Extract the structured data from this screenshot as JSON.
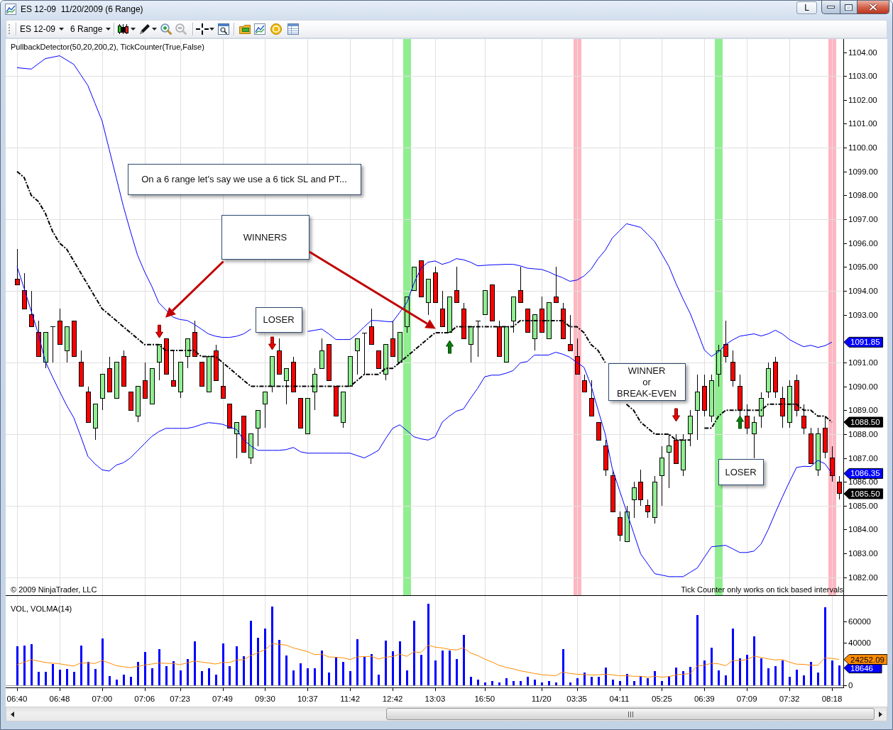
{
  "window": {
    "title": "ES 12-09  11/20/2009 (6 Range)",
    "button": "L"
  },
  "toolbar": {
    "instrument": "ES 12-09",
    "interval": "6 Range"
  },
  "price_panel": {
    "indicator_label": "PullbackDetector(50,20,200,2), TickCounter(True,False)",
    "copyright": "© 2009 NinjaTrader, LLC",
    "notice": "Tick Counter only works on tick based intervals",
    "chart_data": {
      "type": "candlestick",
      "ylim": [
        1081.25,
        1104.55
      ],
      "grid": true,
      "categories": [
        null,
        null,
        null,
        null,
        null,
        null,
        null,
        null,
        null,
        null,
        null,
        null,
        null,
        null,
        null,
        null,
        null,
        null,
        null,
        null,
        null,
        null,
        null,
        null,
        null,
        null,
        null,
        null,
        null,
        null,
        null,
        null,
        null,
        null,
        null,
        null,
        null,
        null,
        null,
        null,
        null,
        null,
        null,
        null,
        null,
        null,
        null,
        null,
        null,
        null,
        null,
        null,
        null,
        null,
        null,
        null,
        null,
        null,
        null,
        null,
        null,
        null,
        null,
        null,
        null,
        null,
        null,
        null,
        null,
        null,
        null,
        null,
        null,
        null,
        null,
        null,
        null,
        null,
        null,
        null,
        null,
        null,
        null,
        null,
        null,
        null,
        null,
        null,
        null,
        null,
        null,
        null,
        null,
        null,
        null,
        null,
        null,
        null,
        null,
        null,
        null,
        null,
        null,
        null,
        null,
        null,
        null,
        null,
        null,
        null,
        null,
        null,
        null,
        null,
        null,
        null,
        null
      ],
      "yticks": [
        {
          "value": 1082,
          "label": "1082.00"
        },
        {
          "value": 1083,
          "label": "1083.00"
        },
        {
          "value": 1084,
          "label": "1084.00"
        },
        {
          "value": 1085,
          "label": "1085.00"
        },
        {
          "value": 1086,
          "label": "1086.00"
        },
        {
          "value": 1087,
          "label": "1087.00"
        },
        {
          "value": 1088,
          "label": "1088.00"
        },
        {
          "value": 1089,
          "label": "1089.00"
        },
        {
          "value": 1090,
          "label": "1090.00"
        },
        {
          "value": 1091,
          "label": "1091.00"
        },
        {
          "value": 1093,
          "label": "1093.00"
        },
        {
          "value": 1094,
          "label": "1094.00"
        },
        {
          "value": 1095,
          "label": "1095.00"
        },
        {
          "value": 1096,
          "label": "1096.00"
        },
        {
          "value": 1097,
          "label": "1097.00"
        },
        {
          "value": 1098,
          "label": "1098.00"
        },
        {
          "value": 1099,
          "label": "1099.00"
        },
        {
          "value": 1100,
          "label": "1100.00"
        },
        {
          "value": 1101,
          "label": "1101.00"
        },
        {
          "value": 1102,
          "label": "1102.00"
        },
        {
          "value": 1103,
          "label": "1103.00"
        },
        {
          "value": 1104,
          "label": "1104.00"
        }
      ],
      "ohlc": [
        [
          1094.5,
          1095.75,
          1094.25,
          1094.25
        ],
        [
          1094,
          1094.75,
          1093.25,
          1093.25
        ],
        [
          1093,
          1094,
          1092.5,
          1092.5
        ],
        [
          1092.25,
          1092.75,
          1091.25,
          1091.25
        ],
        [
          1091,
          1092.25,
          1090.75,
          1092.25
        ],
        [
          1092.5,
          1092.5,
          1091,
          1092.5
        ],
        [
          1092.75,
          1093.25,
          1091.75,
          1091.75
        ],
        [
          1091.5,
          1092.5,
          1091,
          1092.5
        ],
        [
          1092.75,
          1092.75,
          1091.25,
          1091.25
        ],
        [
          1091,
          1091.5,
          1090,
          1090
        ],
        [
          1089.75,
          1090,
          1088.5,
          1088.5
        ],
        [
          1088.25,
          1089.25,
          1087.75,
          1089.25
        ],
        [
          1089.5,
          1090.5,
          1089,
          1090.5
        ],
        [
          1090.75,
          1091.25,
          1089.75,
          1089.75
        ],
        [
          1089.5,
          1091,
          1089.5,
          1091
        ],
        [
          1091.25,
          1091.5,
          1090,
          1090
        ],
        [
          1089.75,
          1089.75,
          1089,
          1089
        ],
        [
          1088.75,
          1090,
          1088.5,
          1090
        ],
        [
          1090.25,
          1091,
          1089.5,
          1089.5
        ],
        [
          1089.25,
          1090.75,
          1089.25,
          1090.75
        ],
        [
          1091,
          1091.75,
          1090.25,
          1091.75
        ],
        [
          1092,
          1092,
          1090.5,
          1090.5
        ],
        [
          1090.25,
          1091.5,
          1090,
          1090
        ],
        [
          1089.75,
          1091,
          1089.5,
          1091
        ],
        [
          1091.25,
          1092,
          1090.75,
          1092
        ],
        [
          1092.25,
          1092.75,
          1091.25,
          1091.25
        ],
        [
          1091,
          1091,
          1090,
          1090
        ],
        [
          1089.75,
          1091.25,
          1089.75,
          1091.25
        ],
        [
          1091.5,
          1091.75,
          1090.25,
          1090.25
        ],
        [
          1090,
          1091,
          1089.5,
          1089.5
        ],
        [
          1089.25,
          1089.25,
          1088.25,
          1088.25
        ],
        [
          1088,
          1088.5,
          1087,
          1088.5
        ],
        [
          1088.75,
          1088.75,
          1087.25,
          1087.25
        ],
        [
          1087,
          1088,
          1086.75,
          1088
        ],
        [
          1088.25,
          1089,
          1087.5,
          1089
        ],
        [
          1089.25,
          1089.75,
          1088.25,
          1089.75
        ],
        [
          1090,
          1091.25,
          1089.75,
          1091.25
        ],
        [
          1091.5,
          1092,
          1090.5,
          1090.5
        ],
        [
          1090.25,
          1090.75,
          1089.25,
          1090.75
        ],
        [
          1091,
          1091.25,
          1089.75,
          1089.75
        ],
        [
          1089.5,
          1089.5,
          1088.25,
          1088.25
        ],
        [
          1088,
          1089.5,
          1088,
          1089.5
        ],
        [
          1089.75,
          1090.75,
          1089,
          1090.5
        ],
        [
          1090.75,
          1092,
          1090.75,
          1091.5
        ],
        [
          1091.75,
          1091.75,
          1090.25,
          1090.25
        ],
        [
          1090,
          1090,
          1088.75,
          1088.75
        ],
        [
          1088.5,
          1089.75,
          1088.25,
          1089.75
        ],
        [
          1090,
          1091.25,
          1090,
          1091.25
        ],
        [
          1091.5,
          1092,
          1090.5,
          1092
        ],
        [
          1092.25,
          1092.25,
          1090.5,
          1092.25
        ],
        [
          1092.5,
          1093.25,
          1091.75,
          1091.75
        ],
        [
          1091.5,
          1091.5,
          1090.75,
          1090.75
        ],
        [
          1090.5,
          1091.75,
          1090.25,
          1091.75
        ],
        [
          1092,
          1092.75,
          1091.25,
          1091.25
        ],
        [
          1091,
          1092.25,
          1091,
          1092.25
        ],
        [
          1092.5,
          1093.75,
          1092.25,
          1093.75
        ],
        [
          1094,
          1095,
          1094,
          1095
        ],
        [
          1095.25,
          1095.25,
          1093.75,
          1093.75
        ],
        [
          1093.5,
          1094.5,
          1093,
          1094.5
        ],
        [
          1094.75,
          1095,
          1093.5,
          1093.5
        ],
        [
          1093.25,
          1094,
          1092.5,
          1092.5
        ],
        [
          1092.25,
          1093.75,
          1092.25,
          1093.75
        ],
        [
          1094,
          1095,
          1093.5,
          1093.5
        ],
        [
          1093.25,
          1093.5,
          1092,
          1092
        ],
        [
          1091.75,
          1092.5,
          1091,
          1092.5
        ],
        [
          1092.75,
          1092.75,
          1091.25,
          1092.75
        ],
        [
          1093,
          1094,
          1093,
          1094
        ],
        [
          1094.25,
          1094.25,
          1092.75,
          1092.75
        ],
        [
          1092.5,
          1092.75,
          1091.25,
          1091.25
        ],
        [
          1091,
          1092.5,
          1091,
          1092.5
        ],
        [
          1092.75,
          1093.75,
          1092.25,
          1093.75
        ],
        [
          1094,
          1095,
          1093.5,
          1093.5
        ],
        [
          1093.25,
          1093.25,
          1092.25,
          1092.25
        ],
        [
          1092,
          1093,
          1091.5,
          1093
        ],
        [
          1093.25,
          1093.75,
          1092.25,
          1092.25
        ],
        [
          1092,
          1093.5,
          1092,
          1093.5
        ],
        [
          1093.75,
          1095,
          1093.5,
          1093.5
        ],
        [
          1093.25,
          1093.5,
          1092,
          1092
        ],
        [
          1091.75,
          1093,
          1091.5,
          1091.5
        ],
        [
          1091.25,
          1092,
          1090.5,
          1090.5
        ],
        [
          1090.25,
          1090.5,
          1089.75,
          1089.75
        ],
        [
          1089.5,
          1090.25,
          1088.75,
          1088.75
        ],
        [
          1088.5,
          1088.5,
          1087.75,
          1087.75
        ],
        [
          1087.5,
          1087.75,
          1086.25,
          1086.5
        ],
        [
          1086.25,
          1086.5,
          1084.75,
          1084.75
        ],
        [
          1084.5,
          1084.75,
          1083.5,
          1083.75
        ],
        [
          1083.5,
          1085,
          1083.5,
          1084.75
        ],
        [
          1085.25,
          1086,
          1084.5,
          1085.75
        ],
        [
          1086,
          1086.5,
          1085,
          1085.25
        ],
        [
          1085,
          1085.25,
          1084.5,
          1084.75
        ],
        [
          1084.5,
          1086.25,
          1084.25,
          1086
        ],
        [
          1086.25,
          1087.5,
          1085,
          1087
        ],
        [
          1087.25,
          1088,
          1085.75,
          1087.5
        ],
        [
          1087.75,
          1088,
          1086.75,
          1086.75
        ],
        [
          1086.5,
          1088,
          1086.25,
          1087.75
        ],
        [
          1088,
          1089,
          1087.5,
          1088.75
        ],
        [
          1089,
          1090.5,
          1087.75,
          1089.75
        ],
        [
          1090,
          1090.5,
          1088.75,
          1089
        ],
        [
          1088.75,
          1090.5,
          1088.5,
          1090.25
        ],
        [
          1090.5,
          1091.75,
          1090,
          1091.5
        ],
        [
          1091.75,
          1092.75,
          1091,
          1091.25
        ],
        [
          1091,
          1091.5,
          1090,
          1090.25
        ],
        [
          1090,
          1090.5,
          1088.75,
          1089
        ],
        [
          1088.75,
          1089.25,
          1088,
          1088.25
        ],
        [
          1088,
          1088.75,
          1087,
          1088.5
        ],
        [
          1088.75,
          1089.75,
          1088.25,
          1089.5
        ],
        [
          1089.75,
          1091,
          1089.5,
          1090.75
        ],
        [
          1091,
          1091.25,
          1089.5,
          1089.75
        ],
        [
          1089.5,
          1090,
          1088.25,
          1088.75
        ],
        [
          1088.5,
          1090.25,
          1088.25,
          1090
        ],
        [
          1090.25,
          1090.5,
          1088.75,
          1089
        ],
        [
          1088.75,
          1089.25,
          1088,
          1088.25
        ],
        [
          1088,
          1088.25,
          1086.75,
          1086.75
        ],
        [
          1086.5,
          1088.25,
          1086.25,
          1088
        ],
        [
          1088.25,
          1088.75,
          1087,
          1087.25
        ],
        [
          1087,
          1087.5,
          1086,
          1086.25
        ],
        [
          1086,
          1086.25,
          1085.25,
          1085.5
        ]
      ],
      "series": [
        {
          "type": "line",
          "color": "#0000ff",
          "values": [
            1103.35,
            1103.32,
            1103.29,
            1103.51,
            1103.73,
            1103.79,
            1103.85,
            1103.67,
            1103.49,
            1103.05,
            1102.6,
            1101.86,
            1101.12,
            1099.93,
            1098.74,
            1097.55,
            1096.5,
            1095.5,
            1094.8,
            1094.2,
            1093.5,
            1093.2,
            1092.9,
            1092.8,
            1092.76,
            1092.6,
            1092.4,
            1092.2,
            1092.1,
            1092.05,
            1092.05,
            1092.1,
            1092.2,
            1092.4,
            null,
            null,
            null,
            null,
            null,
            null,
            null,
            1092.3,
            1092.35,
            1092.4,
            1092.2,
            1091.96,
            1091.96,
            1091.96,
            1092.2,
            1092.5,
            1092.76,
            1092.75,
            1092.72,
            1092.7,
            1093.1,
            1093.5,
            1094.3,
            1094.95,
            1095.2,
            1095.25,
            1095.11,
            1095.2,
            1095.35,
            1095.3,
            1095.2,
            1095.05,
            1095.07,
            1095.09,
            1095.1,
            1095.11,
            1095.11,
            1095.05,
            1094.95,
            1094.92,
            1094.9,
            1094.8,
            1094.66,
            1094.55,
            1094.4,
            1094.45,
            1094.62,
            1094.9,
            1095.35,
            1095.7,
            1096.21,
            1096.51,
            1096.81,
            1096.74,
            1096.66,
            1096.36,
            1096.06,
            1095.54,
            1095.02,
            1094.3,
            1093.65,
            1093.05,
            1092.3,
            1091.52,
            1091.25,
            1091.45,
            1091.75,
            1091.95,
            1092.1,
            1092.15,
            1092.2,
            1092.11,
            1092.2,
            1092.35,
            1092.2,
            1091.96,
            1091.8,
            1091.66,
            1091.72,
            1091.63,
            1091.7,
            1091.85,
            null
          ]
        },
        {
          "type": "line",
          "color": "#0000ff",
          "values": [
            1095.02,
            1094.1,
            1093.15,
            1092.21,
            1091.04,
            1090.4,
            1089.79,
            1089.2,
            1088.69,
            1087.9,
            1087.07,
            1086.75,
            1086.5,
            1086.45,
            1086.7,
            1086.8,
            1087,
            1087.3,
            1087.6,
            1087.9,
            1088.1,
            1088.24,
            1088.24,
            1088.24,
            1088.24,
            1088.3,
            1088.4,
            1088.48,
            1088.45,
            1088.41,
            1088.3,
            1088.19,
            1087.75,
            1087.5,
            1087.32,
            1087.32,
            1087.32,
            1087.32,
            1087.35,
            1087.44,
            1087.26,
            1087.2,
            1087.2,
            1087.2,
            1087.2,
            1087.2,
            1087.2,
            1087.2,
            1087.1,
            1087,
            1087.15,
            1087.32,
            1087.8,
            1088.24,
            1088.39,
            1088.15,
            1087.89,
            1087.8,
            1087.75,
            1087.89,
            1088.5,
            1088.75,
            1088.96,
            1089.05,
            1089.5,
            1089.92,
            1090.4,
            1090.47,
            1090.47,
            1090.55,
            1090.66,
            1090.98,
            1091.04,
            1091.31,
            1091.31,
            1091.31,
            1091.43,
            1091.35,
            1091.22,
            1091,
            1090.8,
            1090.04,
            1089,
            1088,
            1086.55,
            1085.66,
            1084.77,
            1083.87,
            1082.98,
            1082.56,
            1082.15,
            1082.09,
            1082.03,
            1082.03,
            1082.03,
            1082.21,
            1082.39,
            1082.84,
            1083.28,
            1083.31,
            1083.34,
            1083.19,
            1083.04,
            1083.04,
            1083.1,
            1083.4,
            1084,
            1084.7,
            1085.36,
            1086,
            1086.6,
            1086.65,
            1086.64,
            1086.9,
            1086.76,
            1086.35,
            null
          ]
        },
        {
          "type": "line",
          "line_style": "dashdot",
          "color": "#000000",
          "values": [
            1099,
            1098.75,
            1098,
            1097.75,
            1097.25,
            1096.5,
            1096,
            1095.75,
            1095.25,
            1094.75,
            1094.25,
            1093.75,
            1093.25,
            1093,
            1092.75,
            1092.5,
            1092.25,
            1092,
            1091.75,
            1091.75,
            1091.75,
            1091.5,
            1091.5,
            1091.5,
            1091.5,
            1091.5,
            1091.25,
            1091.25,
            1091.25,
            1091,
            1090.75,
            1090.5,
            1090.25,
            1090,
            1090,
            1090,
            1090,
            1090,
            1090,
            1090,
            1090,
            1090,
            1090,
            1090,
            1090,
            1090,
            1090,
            1090,
            1090.25,
            1090.5,
            1090.5,
            1090.5,
            1090.75,
            1090.75,
            1091,
            1091.25,
            1091.5,
            1091.75,
            1092,
            1092.25,
            1092.25,
            1092.25,
            1092.5,
            1092.5,
            1092.5,
            1092.5,
            1092.5,
            1092.5,
            1092.5,
            1092.5,
            1092.5,
            1092.75,
            1092.75,
            1092.75,
            1092.75,
            1092.75,
            1092.75,
            1092.75,
            1092.5,
            1092.5,
            1092.25,
            1091.75,
            1091.5,
            1091,
            null,
            null,
            1089.25,
            1089,
            1088.5,
            1088.25,
            1088,
            1088,
            1088,
            1087.75,
            1087.75,
            1087.75,
            null,
            1088.25,
            1088.25,
            1088.75,
            1089,
            1089,
            1089,
            1089,
            1089,
            1089,
            1089.25,
            1089.25,
            1089.25,
            1089.25,
            1089.25,
            1089,
            1089,
            1088.75,
            1088.75,
            1088.5,
            null
          ]
        },
        {
          "type": "scatter",
          "color": "#e80000",
          "values": [
            null,
            null,
            null,
            null,
            null,
            null,
            null,
            null,
            null,
            null,
            null,
            null,
            null,
            null,
            null,
            null,
            null,
            null,
            null,
            null,
            1092.3,
            null,
            null,
            null,
            null,
            null,
            null,
            null,
            null,
            null,
            null,
            null,
            null,
            null,
            null,
            null,
            1091.8,
            null,
            null,
            null,
            null,
            null,
            null,
            null,
            null,
            null,
            null,
            null,
            null,
            null,
            null,
            null,
            null,
            null,
            null,
            null,
            null,
            null,
            null,
            null,
            null,
            null,
            null,
            null,
            null,
            null,
            null,
            null,
            null,
            null,
            null,
            null,
            null,
            null,
            null,
            null,
            null,
            null,
            null,
            null,
            null,
            null,
            null,
            null,
            null,
            null,
            null,
            null,
            null,
            null,
            null,
            null,
            null,
            1088.8,
            null,
            null,
            null,
            null,
            null,
            null,
            null,
            null,
            null,
            null,
            null,
            null,
            null,
            null,
            null,
            null,
            null,
            null,
            null,
            null,
            null,
            null,
            null
          ]
        },
        {
          "type": "scatter",
          "color": "#0a7d0a",
          "values": [
            null,
            null,
            null,
            null,
            null,
            null,
            null,
            null,
            null,
            null,
            null,
            null,
            null,
            null,
            null,
            null,
            null,
            null,
            null,
            null,
            null,
            null,
            null,
            null,
            null,
            null,
            null,
            null,
            null,
            null,
            null,
            null,
            null,
            null,
            null,
            null,
            null,
            null,
            null,
            null,
            null,
            null,
            null,
            null,
            null,
            null,
            null,
            null,
            null,
            null,
            null,
            null,
            null,
            null,
            null,
            null,
            null,
            null,
            null,
            null,
            null,
            1091.65,
            null,
            null,
            null,
            null,
            null,
            null,
            null,
            null,
            null,
            null,
            null,
            null,
            null,
            null,
            null,
            null,
            null,
            null,
            null,
            null,
            null,
            null,
            null,
            null,
            null,
            null,
            null,
            null,
            null,
            null,
            null,
            null,
            null,
            null,
            null,
            null,
            null,
            null,
            null,
            null,
            1088.5,
            null,
            null,
            null,
            null,
            null,
            null,
            null,
            null,
            null,
            null,
            null,
            null,
            null,
            null
          ]
        }
      ],
      "annotations": [
        "On a 6 range let's say we use a 6 tick SL and PT...",
        "WINNERS",
        "LOSER",
        "WINNER\nor\nBREAK-EVEN",
        "LOSER",
        "1091.85",
        "1088.50",
        "1086.35",
        "1085.50"
      ]
    }
  },
  "volume_panel": {
    "label": "VOL, VOLMA(14)",
    "chart_data": {
      "type": "bar",
      "ylim": [
        0,
        84000
      ],
      "yticks": [
        0,
        40000,
        60000
      ],
      "grid": true,
      "categories": [
        "06:40",
        null,
        null,
        null,
        null,
        null,
        "06:48",
        null,
        null,
        null,
        null,
        null,
        "07:00",
        null,
        null,
        null,
        null,
        null,
        "07:06",
        null,
        null,
        null,
        null,
        "07:23",
        null,
        null,
        null,
        null,
        null,
        "07:49",
        null,
        null,
        null,
        null,
        null,
        "09:30",
        null,
        null,
        null,
        null,
        null,
        "10:37",
        null,
        null,
        null,
        null,
        null,
        "11:42",
        null,
        null,
        null,
        null,
        null,
        "12:42",
        null,
        null,
        null,
        null,
        null,
        "13:03",
        null,
        null,
        null,
        null,
        null,
        null,
        "16:50",
        null,
        null,
        null,
        null,
        null,
        null,
        null,
        "11/20",
        null,
        null,
        null,
        null,
        "03:35",
        null,
        null,
        null,
        null,
        null,
        "04:11",
        null,
        null,
        null,
        null,
        null,
        "05:25",
        null,
        null,
        null,
        null,
        null,
        "06:39",
        null,
        null,
        null,
        null,
        null,
        "07:09",
        null,
        null,
        null,
        null,
        null,
        "07:32",
        null,
        null,
        null,
        null,
        null,
        "08:18",
        null
      ],
      "series": [
        {
          "color": "#0000ff",
          "values": [
            36600,
            37200,
            38500,
            12900,
            12900,
            19700,
            15000,
            15500,
            12900,
            37200,
            21800,
            15500,
            44200,
            9000,
            5100,
            10300,
            7700,
            21800,
            31400,
            16000,
            33800,
            18100,
            22600,
            14200,
            24400,
            41100,
            13400,
            16000,
            9800,
            39500,
            18100,
            36400,
            27500,
            60900,
            45000,
            53100,
            73700,
            42900,
            28000,
            14200,
            20500,
            16000,
            16000,
            32700,
            12100,
            26700,
            21800,
            13400,
            43400,
            26700,
            29300,
            9800,
            42100,
            31900,
            41100,
            14200,
            60900,
            28800,
            76800,
            23100,
            32700,
            32500,
            24900,
            47100,
            7700,
            5100,
            2500,
            3800,
            2500,
            6400,
            3800,
            4300,
            7700,
            5600,
            3000,
            4300,
            3000,
            33800,
            2500,
            6900,
            12100,
            7700,
            7700,
            16600,
            5100,
            4300,
            10800,
            4300,
            8500,
            6400,
            13200,
            4300,
            9000,
            16600,
            13200,
            17100,
            65900,
            23600,
            35100,
            14000,
            9500,
            53600,
            25400,
            28800,
            46000,
            25400,
            16000,
            17900,
            23100,
            8200,
            14700,
            9500,
            22300,
            12100,
            73400,
            23100,
            18646
          ]
        },
        {
          "type": "line",
          "color": "#ff8c00",
          "values": [
            19400,
            21700,
            24100,
            22800,
            21500,
            20800,
            20200,
            19100,
            18100,
            21000,
            21000,
            20500,
            23300,
            21000,
            18400,
            17500,
            16600,
            17800,
            19000,
            20000,
            21000,
            20700,
            20400,
            19500,
            21000,
            22800,
            21900,
            21000,
            20000,
            21500,
            21500,
            23900,
            24000,
            28000,
            30600,
            33500,
            39000,
            38700,
            37700,
            35100,
            33400,
            31700,
            28800,
            29300,
            26700,
            26300,
            25900,
            24100,
            26700,
            27000,
            27200,
            24700,
            26400,
            27000,
            29300,
            27200,
            31400,
            30900,
            37700,
            35900,
            35100,
            33800,
            33200,
            35300,
            30300,
            28000,
            24600,
            22000,
            18900,
            16800,
            15500,
            13700,
            12400,
            11100,
            10000,
            9500,
            9000,
            12400,
            11100,
            10500,
            10000,
            9800,
            9800,
            10500,
            9800,
            9000,
            9000,
            8500,
            8500,
            7700,
            8500,
            7700,
            8200,
            9800,
            10300,
            11100,
            18100,
            18900,
            20700,
            20200,
            18400,
            23300,
            23300,
            24100,
            27300,
            26200,
            24900,
            23900,
            24100,
            21800,
            19900,
            19700,
            18900,
            18900,
            25700,
            25200,
            24252.09
          ]
        }
      ],
      "annotations": [
        "24252.09",
        "18646"
      ]
    }
  }
}
